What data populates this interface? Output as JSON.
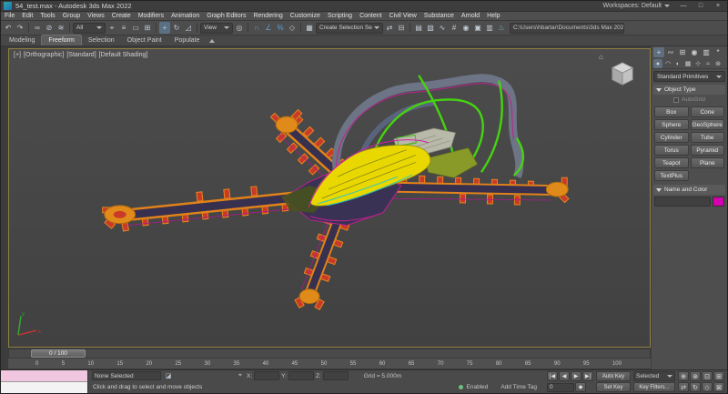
{
  "colors": {
    "viewport_border": "#8f8140",
    "name_color_swatch": "#d400b0",
    "model_green": "#46d410",
    "model_orange": "#e0821a",
    "model_red": "#c93a28",
    "model_yellow": "#e8d800",
    "model_magenta": "#c02090"
  },
  "title_bar": {
    "title": "54_test.max - Autodesk 3ds Max 2022",
    "workspaces_label": "Workspaces: Default",
    "minimize": "—",
    "maximize": "□",
    "close": "×"
  },
  "menu_bar": {
    "items": [
      "File",
      "Edit",
      "Tools",
      "Group",
      "Views",
      "Create",
      "Modifiers",
      "Animation",
      "Graph Editors",
      "Rendering",
      "Customize",
      "Scripting",
      "Content",
      "Civil View",
      "Substance",
      "Arnold",
      "Help"
    ]
  },
  "toolbar": {
    "icons_a": [
      {
        "name": "undo-icon",
        "glyph": "↶"
      },
      {
        "name": "redo-icon",
        "glyph": "↷"
      },
      {
        "name": "separator",
        "glyph": ""
      },
      {
        "name": "select-and-link-icon",
        "glyph": "∞"
      },
      {
        "name": "unlink-selection-icon",
        "glyph": "⊘"
      },
      {
        "name": "bind-to-space-warp-icon",
        "glyph": "≋"
      },
      {
        "name": "separator",
        "glyph": ""
      }
    ],
    "selection_filter_value": "All",
    "icons_b": [
      {
        "name": "select-object-icon",
        "glyph": "⌖"
      },
      {
        "name": "select-by-name-icon",
        "glyph": "≡"
      },
      {
        "name": "rectangular-selection-region-icon",
        "glyph": "▭"
      },
      {
        "name": "window-crossing-icon",
        "glyph": "⊞"
      },
      {
        "name": "separator",
        "glyph": ""
      },
      {
        "name": "select-and-move-icon",
        "glyph": "+",
        "active": true
      },
      {
        "name": "select-and-rotate-icon",
        "glyph": "↻"
      },
      {
        "name": "select-and-scale-icon",
        "glyph": "◿"
      },
      {
        "name": "separator",
        "glyph": ""
      }
    ],
    "view_dropdown_value": "View",
    "icons_c": [
      {
        "name": "use-pivot-point-icon",
        "glyph": "◎"
      },
      {
        "name": "separator",
        "glyph": ""
      },
      {
        "name": "snap-toggle-icon",
        "glyph": "∩",
        "tint": "#5a9fd4"
      },
      {
        "name": "angle-snap-icon",
        "glyph": "∠",
        "tint": "#5a9fd4"
      },
      {
        "name": "percent-snap-icon",
        "glyph": "%",
        "tint": "#5a9fd4"
      },
      {
        "name": "spinner-snap-icon",
        "glyph": "◇"
      },
      {
        "name": "separator",
        "glyph": ""
      },
      {
        "name": "edit-named-selections-icon",
        "glyph": "▦"
      }
    ],
    "selection_set_value": "Create Selection Se",
    "icons_d": [
      {
        "name": "mirror-icon",
        "glyph": "⇄"
      },
      {
        "name": "align-icon",
        "glyph": "⊟"
      },
      {
        "name": "separator",
        "glyph": ""
      },
      {
        "name": "layer-manager-icon",
        "glyph": "▤"
      },
      {
        "name": "ribbon-toggle-icon",
        "glyph": "▧"
      },
      {
        "name": "curve-editor-icon",
        "glyph": "∿"
      },
      {
        "name": "schematic-view-icon",
        "glyph": "#"
      },
      {
        "name": "material-editor-icon",
        "glyph": "◉"
      },
      {
        "name": "render-setup-icon",
        "glyph": "▣"
      },
      {
        "name": "rendered-frame-icon",
        "glyph": "▥"
      },
      {
        "name": "render-icon",
        "glyph": "♨",
        "tint": "#77b7c9"
      }
    ],
    "project_path": "C:\\Users\\hbartar\\Documents\\3ds Max 2022 >"
  },
  "ribbon": {
    "tabs": [
      "Modeling",
      "Freeform",
      "Selection",
      "Object Paint",
      "Populate"
    ],
    "active_tab": "Freeform"
  },
  "viewport": {
    "label_parts": [
      "[+]",
      "[Orthographic]",
      "[Standard]",
      "[Default Shading]"
    ],
    "home_glyph": "⌂",
    "axis_x": "x",
    "axis_y": "y"
  },
  "command_panel": {
    "tabs": [
      {
        "name": "create-tab-icon",
        "glyph": "+",
        "active": true
      },
      {
        "name": "modify-tab-icon",
        "glyph": "∾"
      },
      {
        "name": "hierarchy-tab-icon",
        "glyph": "⊞"
      },
      {
        "name": "motion-tab-icon",
        "glyph": "◉"
      },
      {
        "name": "display-tab-icon",
        "glyph": "▥"
      },
      {
        "name": "utilities-tab-icon",
        "glyph": "*"
      }
    ],
    "categories": [
      {
        "name": "geometry-category-icon",
        "glyph": "●",
        "active": true
      },
      {
        "name": "shapes-category-icon",
        "glyph": "◠"
      },
      {
        "name": "lights-category-icon",
        "glyph": "◐"
      },
      {
        "name": "cameras-category-icon",
        "glyph": "▦"
      },
      {
        "name": "helpers-category-icon",
        "glyph": "⊹"
      },
      {
        "name": "space-warps-category-icon",
        "glyph": "≈"
      },
      {
        "name": "systems-category-icon",
        "glyph": "⊛"
      }
    ],
    "primitives_dropdown": "Standard Primitives",
    "object_type_rollout": "Object Type",
    "autogrid_label": "AutoGrid",
    "object_buttons": [
      "Box",
      "Cone",
      "Sphere",
      "GeoSphere",
      "Cylinder",
      "Tube",
      "Torus",
      "Pyramid",
      "Teapot",
      "Plane",
      "TextPlus"
    ],
    "name_color_rollout": "Name and Color",
    "swatch_color": "#d400b0"
  },
  "timeline": {
    "slider_label": "0 / 100",
    "ticks": [
      "0",
      "5",
      "10",
      "15",
      "20",
      "25",
      "30",
      "35",
      "40",
      "45",
      "50",
      "55",
      "60",
      "65",
      "70",
      "75",
      "80",
      "85",
      "90",
      "95",
      "100"
    ]
  },
  "status_bar": {
    "selection_status": "None Selected",
    "lock_glyph": "◪",
    "abs_glyph": "⌖",
    "coord_x_label": "X:",
    "coord_y_label": "Y:",
    "coord_z_label": "Z:",
    "grid_label": "Grid = 5.000m",
    "prompt": "Click and drag to select and move objects",
    "enabled_label": "Enabled",
    "add_time_tag": "Add Time Tag",
    "playback_icons": [
      {
        "name": "go-to-start-button",
        "glyph": "|◀"
      },
      {
        "name": "previous-frame-button",
        "glyph": "◀"
      },
      {
        "name": "play-button",
        "glyph": "▶"
      },
      {
        "name": "go-to-end-button",
        "glyph": "▶|"
      }
    ],
    "frame_value": "0",
    "key_mode_glyph": "◆",
    "auto_key_label": "Auto Key",
    "set_key_label": "Set Key",
    "selected_dropdown_value": "Selected",
    "key_filters_label": "Key Filters...",
    "nav_icons_row1": [
      {
        "name": "zoom-icon",
        "glyph": "⊕"
      },
      {
        "name": "zoom-all-icon",
        "glyph": "⊛"
      },
      {
        "name": "zoom-extents-icon",
        "glyph": "⊡"
      },
      {
        "name": "zoom-region-icon",
        "glyph": "⊞"
      }
    ],
    "nav_icons_row2": [
      {
        "name": "pan-icon",
        "glyph": "⇄"
      },
      {
        "name": "orbit-icon",
        "glyph": "↻"
      },
      {
        "name": "field-of-view-icon",
        "glyph": "◇"
      },
      {
        "name": "maximize-viewport-toggle-icon",
        "glyph": "⊠"
      }
    ]
  }
}
